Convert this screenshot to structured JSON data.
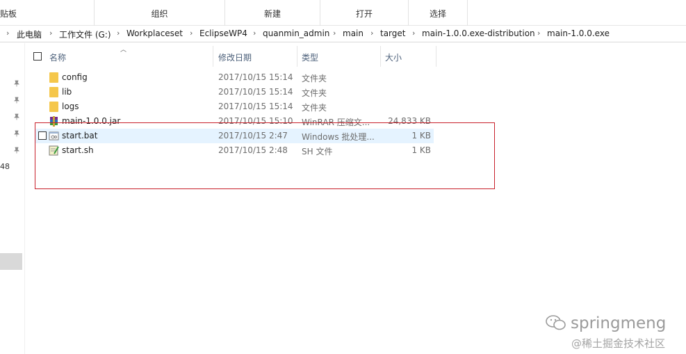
{
  "ribbon": {
    "top_sliver": "",
    "groups": [
      {
        "label": "贴板"
      },
      {
        "label": "组织"
      },
      {
        "label": "新建"
      },
      {
        "label": "打开"
      },
      {
        "label": "选择"
      }
    ]
  },
  "breadcrumb": {
    "items": [
      "此电脑",
      "工作文件 (G:)",
      "Workplaceset",
      "EclipseWP4",
      "quanmin_admin",
      "main",
      "target",
      "main-1.0.0.exe-distribution",
      "main-1.0.0.exe"
    ],
    "separator": "›"
  },
  "nav": {
    "partial_text": "48"
  },
  "columns": {
    "name": "名称",
    "modified": "修改日期",
    "type": "类型",
    "size": "大小"
  },
  "files": [
    {
      "name": "config",
      "date": "2017/10/15 15:14",
      "type": "文件夹",
      "size": "",
      "icon": "folder-icon"
    },
    {
      "name": "lib",
      "date": "2017/10/15 15:14",
      "type": "文件夹",
      "size": "",
      "icon": "folder-icon"
    },
    {
      "name": "logs",
      "date": "2017/10/15 15:14",
      "type": "文件夹",
      "size": "",
      "icon": "folder-icon"
    },
    {
      "name": "main-1.0.0.jar",
      "date": "2017/10/15 15:10",
      "type": "WinRAR 压缩文...",
      "size": "24,833 KB",
      "icon": "winrar-archive-icon"
    },
    {
      "name": "start.bat",
      "date": "2017/10/15 2:47",
      "type": "Windows 批处理...",
      "size": "1 KB",
      "icon": "batch-file-icon"
    },
    {
      "name": "start.sh",
      "date": "2017/10/15 2:48",
      "type": "SH 文件",
      "size": "1 KB",
      "icon": "shell-script-icon"
    }
  ],
  "watermark": {
    "line1": "springmeng",
    "line2": "@稀土掘金技术社区"
  },
  "colors": {
    "selection": "#e5f3ff",
    "annotation": "#c8202a",
    "folder": "#f5c74b"
  }
}
